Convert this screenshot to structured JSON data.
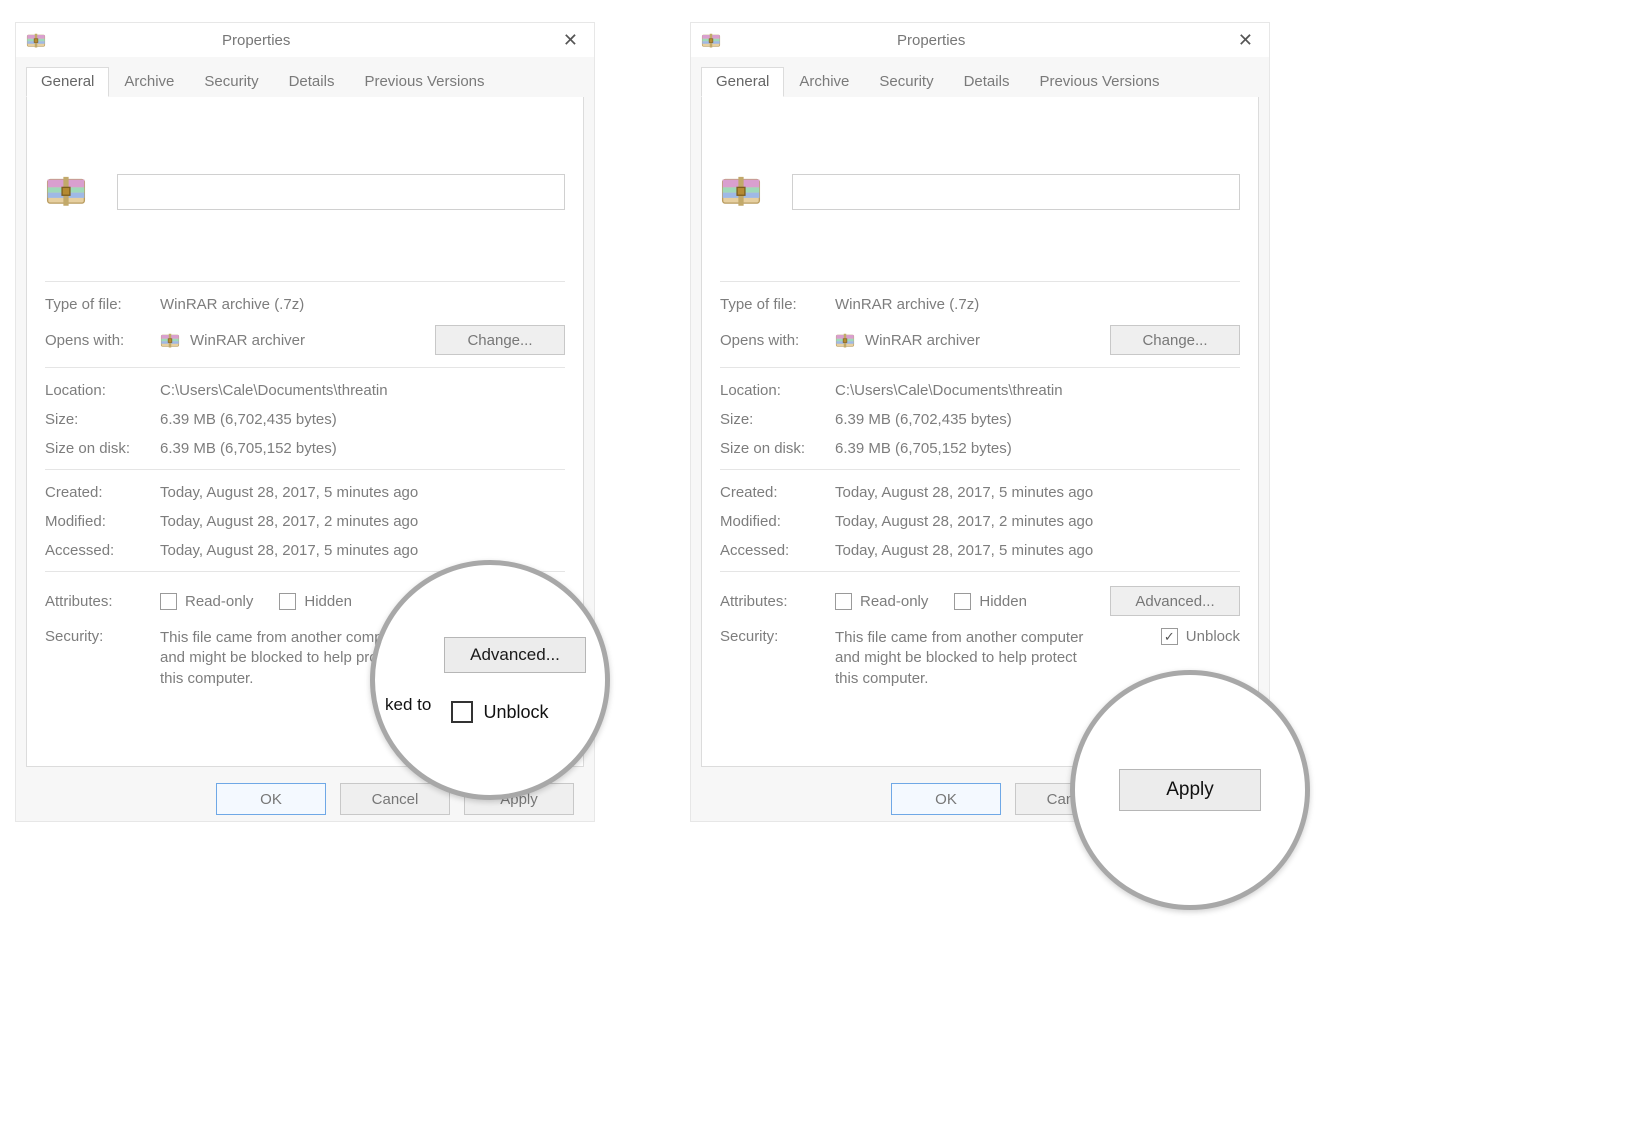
{
  "dialog_title": "Properties",
  "tabs": [
    "General",
    "Archive",
    "Security",
    "Details",
    "Previous Versions"
  ],
  "labels": {
    "type_of_file": "Type of file:",
    "opens_with": "Opens with:",
    "change": "Change...",
    "location": "Location:",
    "size": "Size:",
    "size_on_disk": "Size on disk:",
    "created": "Created:",
    "modified": "Modified:",
    "accessed": "Accessed:",
    "attributes": "Attributes:",
    "read_only": "Read-only",
    "hidden": "Hidden",
    "advanced": "Advanced...",
    "security": "Security:",
    "unblock": "Unblock",
    "ok": "OK",
    "cancel": "Cancel",
    "apply": "Apply"
  },
  "values": {
    "type_of_file": "WinRAR archive (.7z)",
    "opens_with": "WinRAR archiver",
    "location": "C:\\Users\\Cale\\Documents\\threatin",
    "size": "6.39 MB (6,702,435 bytes)",
    "size_on_disk": "6.39 MB (6,705,152 bytes)",
    "created": "Today, August 28, 2017, 5 minutes ago",
    "modified": "Today, August 28, 2017, 2 minutes ago",
    "accessed": "Today, August 28, 2017, 5 minutes ago",
    "security_msg": "This file came from another computer and might be blocked to help protect this computer."
  },
  "left_dialog": {
    "unblock_checked": false
  },
  "right_dialog": {
    "unblock_checked": true
  },
  "lens": {
    "left": {
      "advanced": "Advanced...",
      "unblock": "Unblock",
      "fragment": "ked to"
    },
    "right": {
      "apply": "Apply"
    }
  }
}
